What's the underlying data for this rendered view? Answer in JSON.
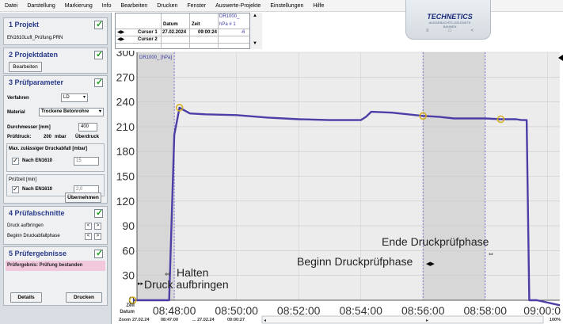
{
  "menu": [
    "Datei",
    "Darstellung",
    "Markierung",
    "Info",
    "Bearbeiten",
    "Drucken",
    "Fenster",
    "Auswerte-Projekte",
    "Einstellungen",
    "Hilfe"
  ],
  "logo": {
    "brand": "TECHNETICS",
    "tagline": "AUSGEBUCHTE-GELENKTE BAHNEN",
    "nav": [
      "≡",
      "□",
      "<"
    ]
  },
  "sections": {
    "projekt": {
      "title": "1 Projekt",
      "file": "EN1610Luft_Prüfung.PRN"
    },
    "projektdaten": {
      "title": "2 Projektdaten",
      "button": "Bearbeiten"
    },
    "pruefparameter": {
      "title": "3 Prüfparameter",
      "verfahren_label": "Verfahren",
      "verfahren_value": "LD",
      "material_label": "Material",
      "material_value": "Trockene Betonrohre",
      "durchmesser_label": "Durchmesser [mm]",
      "durchmesser_value": "400",
      "pruefdruck_label": "Prüfdruck:",
      "pruefdruck_value": "200",
      "pruefdruck_unit": "mbar",
      "pruefdruck_mode": "Überdruck",
      "druckabfall_label": "Max. zulässiger Druckabfall [mbar]",
      "nach_en_1": "Nach EN1610",
      "druckabfall_value": "15",
      "pruefzeit_label": "Prüfzeit [min]",
      "nach_en_2": "Nach EN1610",
      "pruefzeit_value": "2,0",
      "apply_button": "Übernehmen"
    },
    "pruefabschnitte": {
      "title": "4 Prüfabschnitte",
      "row1": "Druck aufbringen",
      "row2": "Beginn Druckabfallphase",
      "prev": "<",
      "next": ">"
    },
    "pruefergebnisse": {
      "title": "5 Prüfergebnisse",
      "result": "Prüfergebnis:  Prüfung bestanden",
      "details_button": "Details",
      "print_button": "Drucken"
    }
  },
  "cursor_table": {
    "header_channel": "DR1000_",
    "header_date": "Datum",
    "header_time": "Zeit",
    "header_unit": "hPa # 1",
    "rows": [
      {
        "label": "Cursor 1",
        "date": "27.02.2024",
        "time": "09:00:24",
        "value": "-6"
      },
      {
        "label": "Cursor 2",
        "date": "",
        "time": "",
        "value": ""
      }
    ]
  },
  "chart_data": {
    "type": "line",
    "series": [
      {
        "name": "DR1000_",
        "x": [
          "08:46:40",
          "08:47:20",
          "08:47:50",
          "08:48:00",
          "08:48:10",
          "08:48:30",
          "08:49:00",
          "08:50:00",
          "08:51:00",
          "08:52:00",
          "08:53:00",
          "08:54:00",
          "08:54:10",
          "08:54:20",
          "08:55:00",
          "08:56:00",
          "08:56:30",
          "08:57:00",
          "08:58:00",
          "08:58:30",
          "08:59:00",
          "08:59:10",
          "08:59:20",
          "08:59:25",
          "08:59:40",
          "09:00:24"
        ],
        "y": [
          0,
          0,
          0,
          200,
          233,
          226,
          225,
          224,
          221,
          219,
          218,
          218,
          222,
          228,
          227,
          223,
          222,
          220,
          220,
          219,
          219,
          218,
          218,
          0,
          0,
          -6
        ]
      }
    ],
    "series_tag": "DR1000_ [hPa]",
    "x_ticks": [
      "08:48:00",
      "08:50:00",
      "08:52:00",
      "08:54:00",
      "08:56:00",
      "08:58:00",
      "09:00:0"
    ],
    "y_ticks": [
      "0",
      "30",
      "60",
      "90",
      "120",
      "150",
      "180",
      "210",
      "240",
      "270",
      "300"
    ],
    "ylim": [
      0,
      300
    ],
    "xlim": [
      "08:46:48",
      "09:00:24"
    ],
    "markers": [
      "08:48:00",
      "08:56:00",
      "08:58:00"
    ],
    "shaded_ranges": [
      [
        "08:46:48",
        "08:48:00"
      ],
      [
        "08:56:00",
        "08:58:00"
      ]
    ],
    "annotations": {
      "druck_aufbringen": "Druck aufbringen",
      "halten": "Halten",
      "beginn": "Beginn Druckprüfphase",
      "ende": "Ende Druckprüfphase"
    },
    "axis_corner": {
      "zeit": "Zeit",
      "datum": "Datum",
      "zoom": "Zoom"
    },
    "footer": {
      "start_date": "27.02.24",
      "start_time": "08:47:00",
      "end_date": "... 27.02.24",
      "end_time": "09:00:27",
      "zoom_pct": "100%"
    }
  },
  "colors": {
    "line": "#4b3ea6",
    "shade": "#d7d7d7",
    "plot_bg": "#ececec",
    "marker": "#d4b020",
    "result_bg": "#f2c8dc"
  }
}
